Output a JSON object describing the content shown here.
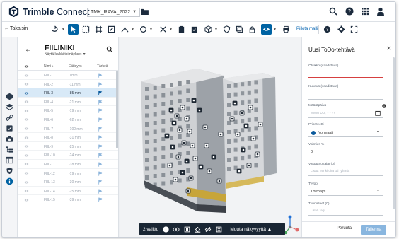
{
  "app": {
    "brand_bold": "Trimble",
    "brand_light": "Connect",
    "project": "TMK_RAVA_2022"
  },
  "toolbar": {
    "back_label": "Takaisin",
    "hide_model_label": "Piilota malli"
  },
  "list_panel": {
    "title": "FIILINIKI",
    "subtitle": "Näytä kaikki toimäykset ▼",
    "columns": {
      "name": "Nimi ↓",
      "distance": "Etäisyys",
      "priority": "Tärkeä"
    },
    "rows": [
      {
        "name": "FIIL-1",
        "distance": "0 mm",
        "selected": false
      },
      {
        "name": "FIIL-2",
        "distance": "-11 mm",
        "selected": false
      },
      {
        "name": "FIIL-3",
        "distance": "-85 mm",
        "selected": true
      },
      {
        "name": "FIIL-4",
        "distance": "-21 mm",
        "selected": false
      },
      {
        "name": "FIIL-5",
        "distance": "-19 mm",
        "selected": false
      },
      {
        "name": "FIIL-6",
        "distance": "-62 mm",
        "selected": false
      },
      {
        "name": "FIIL-7",
        "distance": "-100 mm",
        "selected": false
      },
      {
        "name": "FIIL-8",
        "distance": "-31 mm",
        "selected": false
      },
      {
        "name": "FIIL-9",
        "distance": "-25 mm",
        "selected": false
      },
      {
        "name": "FIIL-10",
        "distance": "-24 mm",
        "selected": false
      },
      {
        "name": "FIIL-11",
        "distance": "-18 mm",
        "selected": false
      },
      {
        "name": "FIIL-12",
        "distance": "-19 mm",
        "selected": false
      },
      {
        "name": "FIIL-13",
        "distance": "-30 mm",
        "selected": false
      },
      {
        "name": "FIIL-14",
        "distance": "-25 mm",
        "selected": false
      },
      {
        "name": "FIIL-15",
        "distance": "-39 mm",
        "selected": false
      }
    ]
  },
  "viewer": {
    "selection_count": "2 valittu",
    "more_visibility": "Muuta näkyvyyttä ▲"
  },
  "todo_form": {
    "title": "Uusi ToDo-tehtävä",
    "fields": {
      "title_label": "Otsikko (vaadittava)",
      "description_label": "Kuvaus (vaadittava)",
      "due_label": "Määräpäivä",
      "due_placeholder": "MMM DD, YYYY",
      "priority_label": "Prioriteetti",
      "priority_value": "Normaali",
      "progress_label": "Valmius %",
      "progress_value": "0",
      "assignees_label": "Vastaanottajat (0)",
      "assignees_placeholder": "Lisää henkilöitä tai ryhmiä",
      "type_label": "Tyyppi",
      "type_value": "Törmäys",
      "tags_label": "Tunnisteet (0)",
      "tags_placeholder": "Lisää tagi"
    },
    "cancel_label": "Peruuta",
    "save_label": "Tallenna"
  },
  "colors": {
    "accent": "#0063a3",
    "save_disabled": "#89b6df",
    "dark_bar": "#1a2634"
  }
}
